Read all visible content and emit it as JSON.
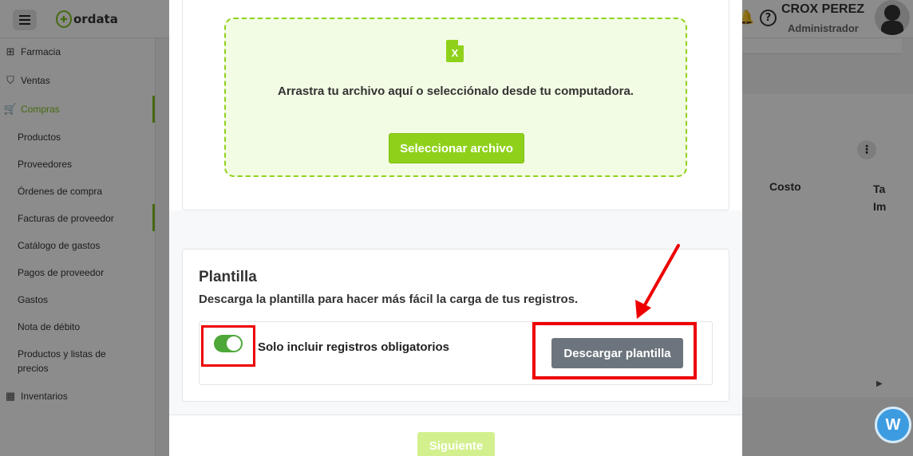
{
  "header": {
    "logo_text": "ordata",
    "user_name": "CROX PEREZ",
    "user_role": "Administrador"
  },
  "sidebar": {
    "items": [
      {
        "label": "Farmacia",
        "icon": "pharmacy-icon"
      },
      {
        "label": "Ventas",
        "icon": "tag-icon"
      },
      {
        "label": "Compras",
        "icon": "cart-icon",
        "active": true
      },
      {
        "label": "Inventarios",
        "icon": "boxes-icon"
      }
    ],
    "subitems": [
      "Productos",
      "Proveedores",
      "Órdenes de compra",
      "Facturas de proveedor",
      "Catálogo de gastos",
      "Pagos de proveedor",
      "Gastos",
      "Nota de débito",
      "Productos y listas de precios"
    ]
  },
  "background_table": {
    "col_costo": "Costo",
    "col_ta_line1": "Ta",
    "col_ta_line2": "Im"
  },
  "modal": {
    "upload": {
      "file_icon_letter": "X",
      "drop_text": "Arrastra tu archivo aquí o selecciónalo desde tu computadora.",
      "select_button": "Seleccionar archivo"
    },
    "template": {
      "title": "Plantilla",
      "description": "Descarga la plantilla para hacer más fácil la carga de tus registros.",
      "toggle_label": "Solo incluir registros obligatorios",
      "toggle_on": true,
      "download_button": "Descargar plantilla"
    },
    "footer": {
      "next_button": "Siguiente"
    }
  },
  "colors": {
    "brand_green": "#8fd11a",
    "toggle_green": "#4ea839",
    "highlight_red": "#e00000",
    "download_gray": "#6c757d"
  }
}
